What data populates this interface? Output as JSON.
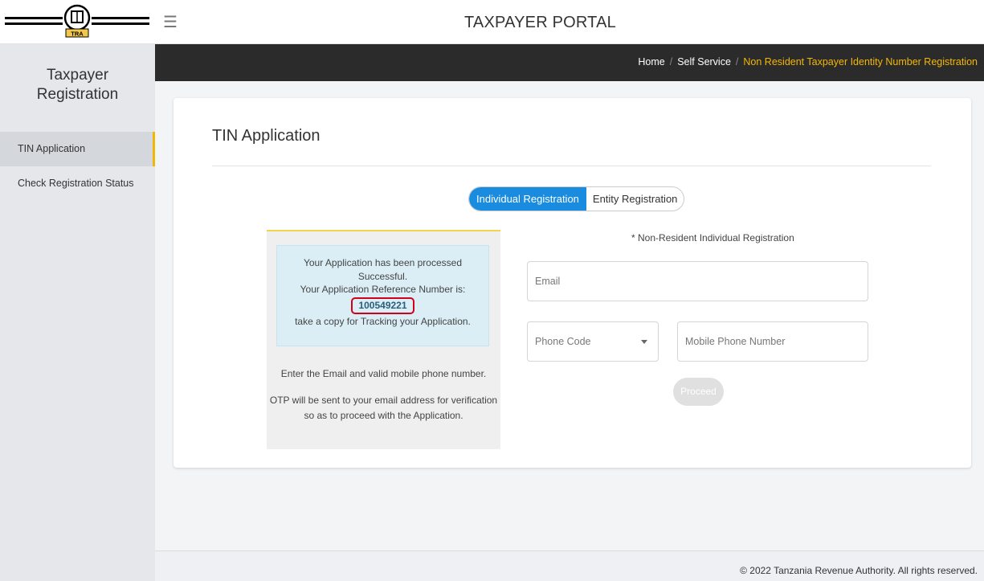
{
  "header": {
    "portal_title": "TAXPAYER PORTAL",
    "logo_text": "TRA",
    "menu_icon": "hamburger-icon"
  },
  "sidebar": {
    "title": "Taxpayer Registration",
    "items": [
      {
        "label": "TIN Application",
        "active": true
      },
      {
        "label": "Check Registration Status",
        "active": false
      }
    ]
  },
  "breadcrumb": {
    "items": [
      "Home",
      "Self Service"
    ],
    "current": "Non Resident Taxpayer Identity Number Registration"
  },
  "main": {
    "title": "TIN Application",
    "tabs": [
      {
        "label": "Individual Registration",
        "active": true
      },
      {
        "label": "Entity Registration",
        "active": false
      }
    ],
    "success": {
      "line1": "Your Application has been processed",
      "line2": "Successful.",
      "line3": "Your Application Reference Number is:",
      "reference_number": "100549221",
      "line4": "take a copy for Tracking your Application."
    },
    "instructions": {
      "line1": "Enter the Email and valid mobile phone number.",
      "line2": "OTP will be sent to your email address for verification",
      "line3": "so as to proceed with the Application."
    },
    "form": {
      "caption": "* Non-Resident Individual Registration",
      "email_placeholder": "Email",
      "phone_code_placeholder": "Phone Code",
      "mobile_placeholder": "Mobile Phone Number",
      "proceed_label": "Proceed"
    }
  },
  "footer": {
    "text": "© 2022 Tanzania Revenue Authority. All rights reserved."
  },
  "colors": {
    "accent": "#1a8ce0",
    "highlight": "#f2b705",
    "dark_bar": "#2b2b2b",
    "ref_border": "#d0021b"
  }
}
